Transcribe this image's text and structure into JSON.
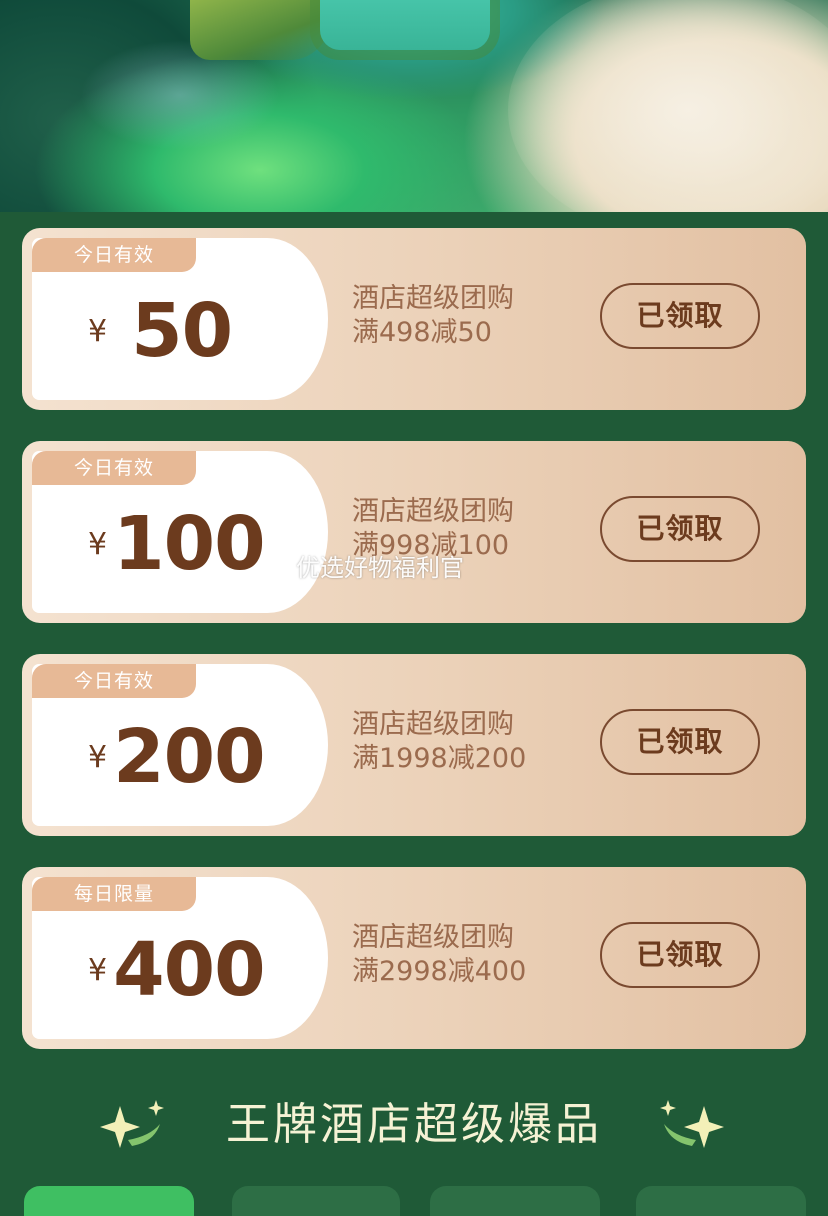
{
  "coupons": [
    {
      "tag": "今日有效",
      "currency": "¥",
      "amount": "50",
      "title": "酒店超级团购",
      "rule": "满498减50",
      "button": "已领取"
    },
    {
      "tag": "今日有效",
      "currency": "¥",
      "amount": "100",
      "title": "酒店超级团购",
      "rule": "满998减100",
      "button": "已领取"
    },
    {
      "tag": "今日有效",
      "currency": "¥",
      "amount": "200",
      "title": "酒店超级团购",
      "rule": "满1998减200",
      "button": "已领取"
    },
    {
      "tag": "每日限量",
      "currency": "¥",
      "amount": "400",
      "title": "酒店超级团购",
      "rule": "满2998减400",
      "button": "已领取"
    }
  ],
  "watermark": "优选好物福利官",
  "section": {
    "title": "王牌酒店超级爆品"
  },
  "colors": {
    "background": "#1f5a37",
    "accent_brown": "#6c3b1e",
    "tag_fill": "#e7b996",
    "title_text": "#f5f2d4"
  }
}
